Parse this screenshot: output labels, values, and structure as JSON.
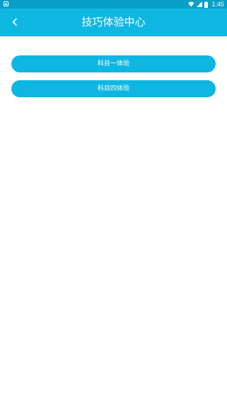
{
  "status_bar": {
    "time": "1:45",
    "icons": [
      "notification-icon",
      "wifi-icon",
      "signal-icon",
      "battery-icon"
    ]
  },
  "app_bar": {
    "title": "技巧体验中心",
    "back_icon": "chevron-left-icon"
  },
  "buttons": [
    {
      "label": "科目一体验"
    },
    {
      "label": "科目四体验"
    }
  ],
  "colors": {
    "status_bar": "#0a9fc6",
    "app_bar": "#0eb7e2",
    "button": "#0eb7e2",
    "text_on_accent": "#ffffff",
    "background": "#ffffff"
  }
}
